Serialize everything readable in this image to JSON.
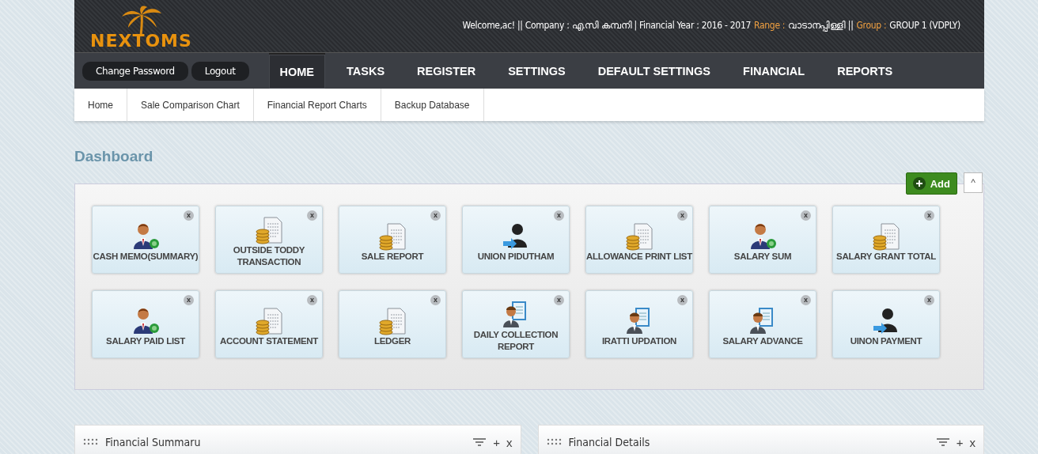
{
  "header": {
    "logo": "NEXTOMS",
    "user_info": [
      {
        "text": "Welcome,ac! || Company : എ.സി കമ്പനി | Financial Year : 2016 - 2017",
        "accent": false
      },
      {
        "text": "Range :",
        "accent": true
      },
      {
        "text": "വാടാനപ്പിള്ളി ||",
        "accent": false
      },
      {
        "text": "Group :",
        "accent": true
      },
      {
        "text": "GROUP 1 (VDPLY)",
        "accent": false
      }
    ]
  },
  "account_buttons": [
    "Change Password",
    "Logout"
  ],
  "nav": [
    {
      "label": "HOME",
      "selected": true
    },
    {
      "label": "TASKS",
      "selected": false
    },
    {
      "label": "REGISTER",
      "selected": false
    },
    {
      "label": "SETTINGS",
      "selected": false
    },
    {
      "label": "DEFAULT SETTINGS",
      "selected": false
    },
    {
      "label": "FINANCIAL",
      "selected": false
    },
    {
      "label": "REPORTS",
      "selected": false
    }
  ],
  "subnav": [
    "Home",
    "Sale Comparison Chart",
    "Financial Report Charts",
    "Backup Database"
  ],
  "dashboard": {
    "title": "Dashboard",
    "add_button": "Add",
    "collapse": "^",
    "tiles": [
      {
        "label": "CASH MEMO(SUMMARY)",
        "kind": "salary",
        "close": "x"
      },
      {
        "label": "OUTSIDE TODDY TRANSACTION",
        "kind": "report",
        "close": "x"
      },
      {
        "label": "SALE REPORT",
        "kind": "report",
        "close": "x"
      },
      {
        "label": "UNION PIDUTHAM",
        "kind": "transfer",
        "close": "x"
      },
      {
        "label": "ALLOWANCE PRINT LIST",
        "kind": "report",
        "close": "x"
      },
      {
        "label": "SALARY SUM",
        "kind": "salary",
        "close": "x"
      },
      {
        "label": "SALARY GRANT TOTAL",
        "kind": "report",
        "close": "x"
      },
      {
        "label": "SALARY PAID LIST",
        "kind": "salary",
        "close": "x"
      },
      {
        "label": "ACCOUNT STATEMENT",
        "kind": "report",
        "close": "x"
      },
      {
        "label": "LEDGER",
        "kind": "report",
        "close": "x"
      },
      {
        "label": "DAILY COLLECTION REPORT",
        "kind": "staff",
        "close": "x"
      },
      {
        "label": "IRATTI UPDATION",
        "kind": "staff",
        "close": "x"
      },
      {
        "label": "SALARY ADVANCE",
        "kind": "staff",
        "close": "x"
      },
      {
        "label": "UINON PAYMENT",
        "kind": "transfer",
        "close": "x"
      }
    ]
  },
  "widgets": [
    {
      "title": "Financial Summaru",
      "plus": "+",
      "close": "x"
    },
    {
      "title": "Financial Details",
      "plus": "+",
      "close": "x"
    }
  ]
}
